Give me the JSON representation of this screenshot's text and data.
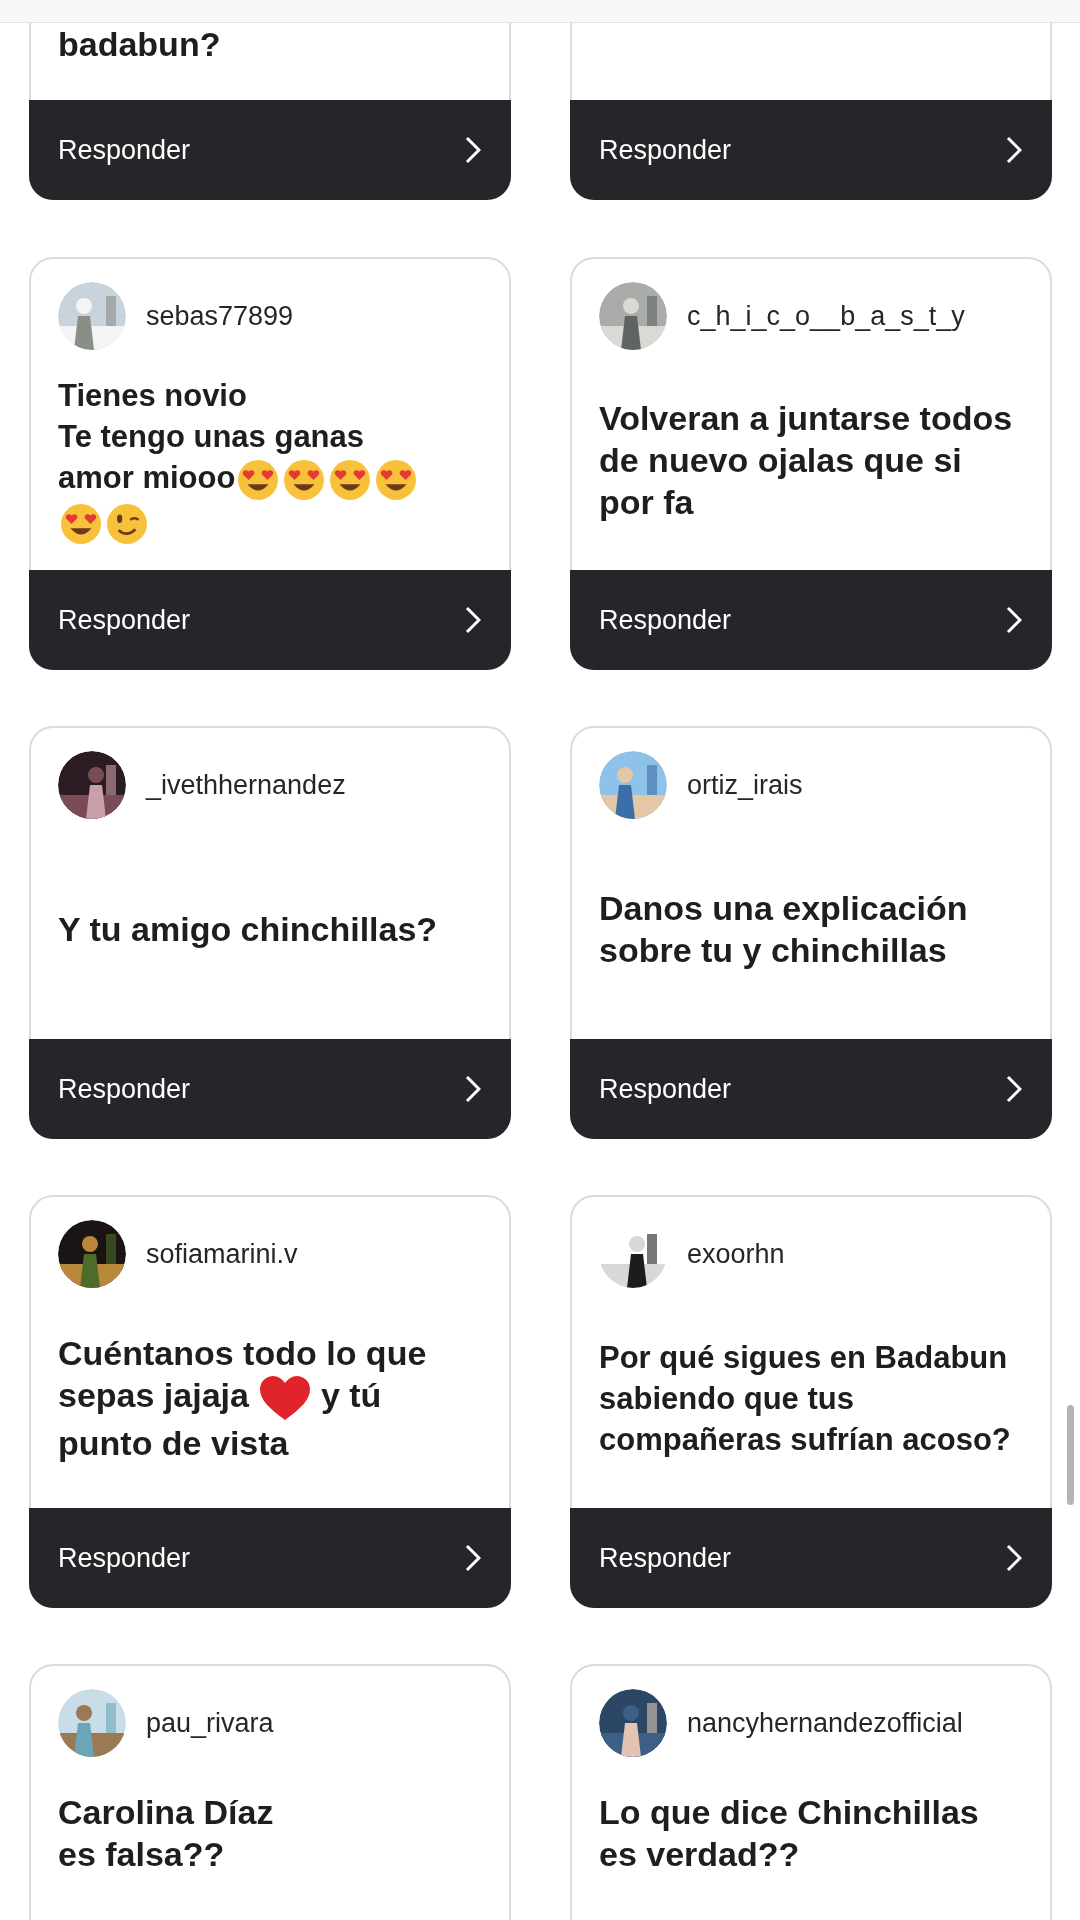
{
  "top_row": [
    {
      "message": [
        {
          "kind": "text",
          "text": "badabun?"
        }
      ],
      "button": "Responder"
    },
    {
      "button": "Responder"
    }
  ],
  "cards": [
    {
      "username": "sebas77899",
      "message": [
        {
          "kind": "text",
          "text": "Tienes novio"
        },
        {
          "kind": "break"
        },
        {
          "kind": "text",
          "text": "Te tengo unas ganas"
        },
        {
          "kind": "break"
        },
        {
          "kind": "text",
          "text": "amor miooo"
        },
        {
          "kind": "heart_eyes"
        },
        {
          "kind": "heart_eyes"
        },
        {
          "kind": "heart_eyes"
        },
        {
          "kind": "heart_eyes"
        },
        {
          "kind": "break"
        },
        {
          "kind": "heart_eyes"
        },
        {
          "kind": "wink"
        }
      ],
      "button": "Responder"
    },
    {
      "username": "c_h_i_c_o__b_a_s_t_y",
      "message": [
        {
          "kind": "text",
          "text": "Volveran a juntarse todos de nuevo ojalas que si por fa"
        }
      ],
      "button": "Responder"
    },
    {
      "username": "_ivethhernandez",
      "message": [
        {
          "kind": "text",
          "text": "Y tu amigo chinchillas?"
        }
      ],
      "button": "Responder"
    },
    {
      "username": "ortiz_irais",
      "message": [
        {
          "kind": "text",
          "text": "Danos una explicación sobre tu y chinchillas"
        }
      ],
      "button": "Responder"
    },
    {
      "username": "sofiamarini.v",
      "message": [
        {
          "kind": "text",
          "text": "Cuéntanos todo lo que"
        },
        {
          "kind": "break"
        },
        {
          "kind": "text",
          "text": "sepas jajaja"
        },
        {
          "kind": "heart"
        },
        {
          "kind": "text",
          "text": "y tú"
        },
        {
          "kind": "break"
        },
        {
          "kind": "text",
          "text": "punto de vista"
        }
      ],
      "button": "Responder"
    },
    {
      "username": "exoorhn",
      "message": [
        {
          "kind": "text",
          "text": "Por qué sigues en Badabun sabiendo que tus compañeras sufrían acoso?"
        }
      ],
      "button": "Responder"
    },
    {
      "username": "pau_rivara",
      "message": [
        {
          "kind": "text",
          "text": "Carolina Díaz\nes falsa??"
        }
      ]
    },
    {
      "username": "nancyhernandezofficial",
      "message": [
        {
          "kind": "text",
          "text": "Lo que dice Chinchillas es verdad??"
        }
      ]
    }
  ]
}
